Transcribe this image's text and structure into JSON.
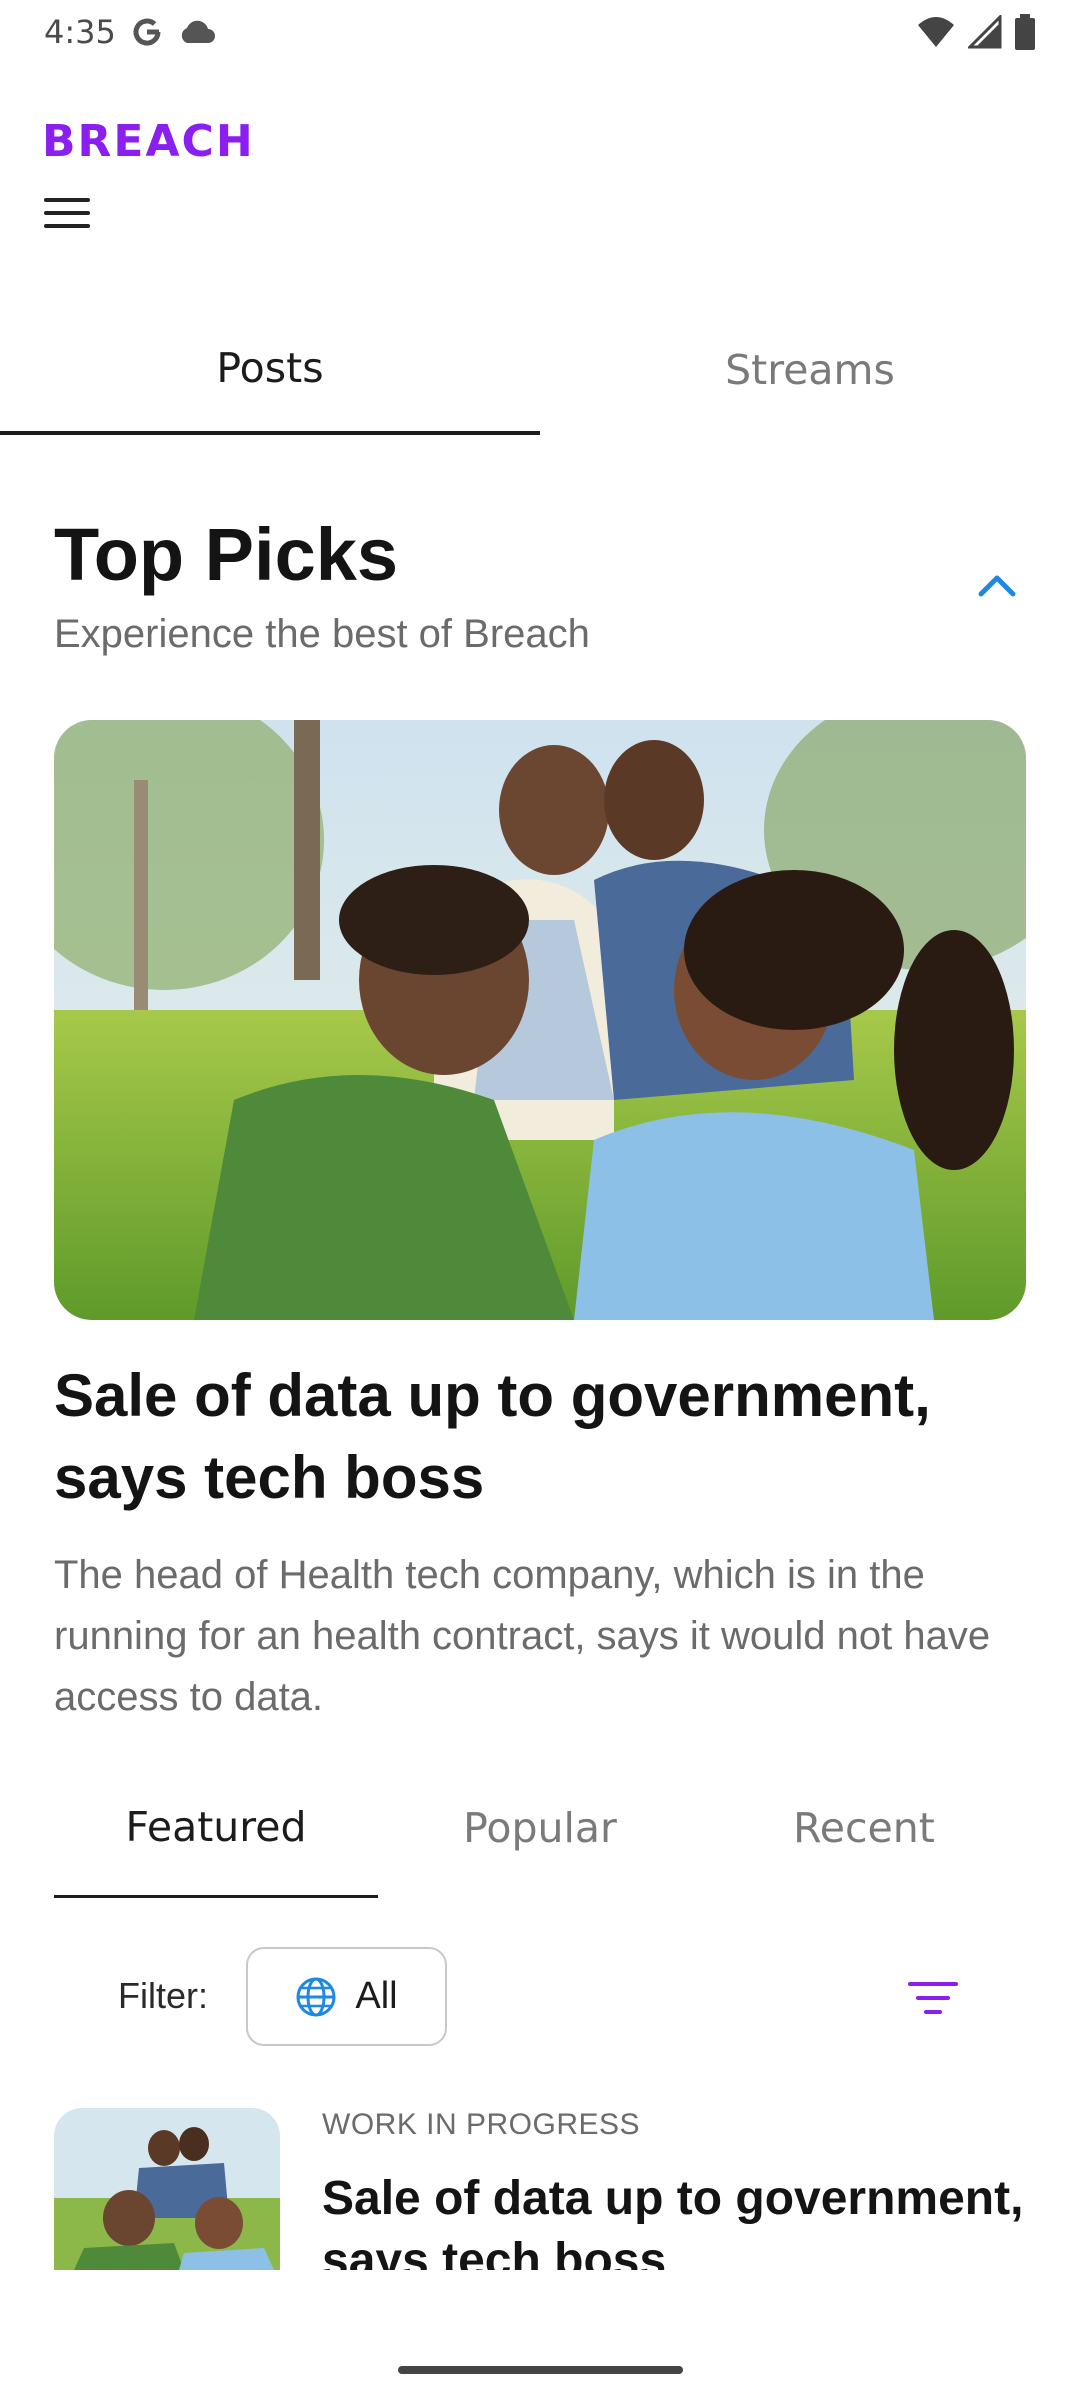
{
  "status_bar": {
    "time": "4:35"
  },
  "app": {
    "logo": "BREACH"
  },
  "main_tabs": [
    {
      "label": "Posts"
    },
    {
      "label": "Streams"
    }
  ],
  "top_picks": {
    "title": "Top Picks",
    "subtitle": "Experience the best of Breach",
    "hero_title": "Sale of data up to government, says tech boss",
    "hero_description": "The head of Health tech company, which is in the running for an health contract, says it would not have access to data."
  },
  "sub_tabs": [
    {
      "label": "Featured"
    },
    {
      "label": "Popular"
    },
    {
      "label": "Recent"
    }
  ],
  "filter": {
    "label": "Filter:",
    "selected": "All"
  },
  "list": [
    {
      "category": "WORK IN PROGRESS",
      "title": "Sale of data up to government, says tech boss"
    }
  ],
  "colors": {
    "brand": "#8a1ff0",
    "accent_blue": "#1e88e5"
  }
}
